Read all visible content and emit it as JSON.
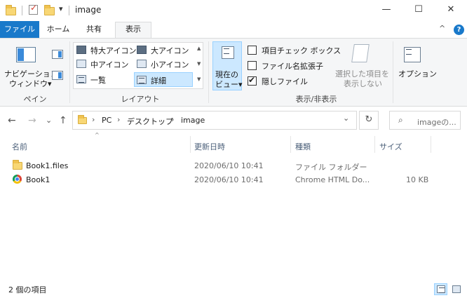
{
  "window": {
    "title": "image",
    "controls": {
      "minimize": "—",
      "maximize": "☐",
      "close": "✕"
    }
  },
  "quick_access": {
    "dropdown": "▾",
    "separator": "|"
  },
  "ribbon_tabs": [
    {
      "label": "ファイル"
    },
    {
      "label": "ホーム"
    },
    {
      "label": "共有"
    },
    {
      "label": "表示"
    }
  ],
  "ribbon_collapse": "^",
  "help_label": "?",
  "pane_group": {
    "nav_pane_line1": "ナビゲーション",
    "nav_pane_line2": "ウィンドウ▾",
    "label": "ペイン"
  },
  "layout_group": {
    "items": [
      {
        "label": "特大アイコン"
      },
      {
        "label": "大アイコン"
      },
      {
        "label": "中アイコン"
      },
      {
        "label": "小アイコン"
      },
      {
        "label": "一覧"
      },
      {
        "label": "詳細"
      }
    ],
    "selected": "詳細",
    "label": "レイアウト"
  },
  "current_view": {
    "line1": "現在の",
    "line2": "ビュー▾"
  },
  "show_hide_group": {
    "checkboxes": [
      {
        "label": "項目チェック ボックス",
        "checked": false
      },
      {
        "label": "ファイル名拡張子",
        "checked": false
      },
      {
        "label": "隠しファイル",
        "checked": true
      }
    ],
    "hide_selected_line1": "選択した項目を",
    "hide_selected_line2": "表示しない",
    "label": "表示/非表示"
  },
  "options_label": "オプション",
  "address": {
    "crumbs": [
      "PC",
      "デスクトップ",
      "image"
    ],
    "separator": "›",
    "dropdown": "⌄"
  },
  "nav": {
    "back": "←",
    "forward": "→",
    "recent": "⌄",
    "up": "↑",
    "refresh": "↻"
  },
  "search": {
    "placeholder": "imageの...",
    "icon": "magnifier-icon"
  },
  "columns": {
    "name": "名前",
    "modified": "更新日時",
    "type": "種類",
    "size": "サイズ",
    "sort": "^"
  },
  "files": [
    {
      "name": "Book1.files",
      "modified": "2020/06/10 10:41",
      "type": "ファイル フォルダー",
      "size": "",
      "icon": "folder-icon"
    },
    {
      "name": "Book1",
      "modified": "2020/06/10 10:41",
      "type": "Chrome HTML Do...",
      "size": "10 KB",
      "icon": "chrome-icon"
    }
  ],
  "status": {
    "count_text": "2 個の項目"
  },
  "colors": {
    "accent": "#1979ca",
    "selected_bg": "#cce8ff",
    "folder": "#f8d775"
  }
}
